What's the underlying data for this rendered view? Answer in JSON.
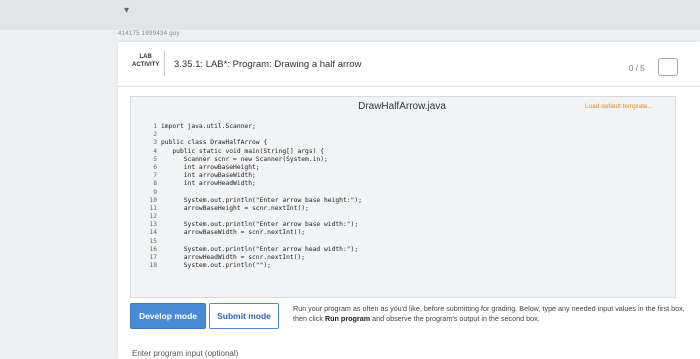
{
  "breadcrumb": "414175 1999434 goy",
  "lab": {
    "type_line1": "LAB",
    "type_line2": "ACTIVITY",
    "title": "3.35.1: LAB*: Program: Drawing a half arrow",
    "score": "0 / 5"
  },
  "editor": {
    "file_name": "DrawHalfArrow.java",
    "load_default_label": "Load default template...",
    "lines": [
      {
        "n": "1",
        "text": "import java.util.Scanner;"
      },
      {
        "n": "2",
        "text": ""
      },
      {
        "n": "3",
        "text": "public class DrawHalfArrow {"
      },
      {
        "n": "4",
        "text": "   public static void main(String[] args) {"
      },
      {
        "n": "5",
        "text": "      Scanner scnr = new Scanner(System.in);"
      },
      {
        "n": "6",
        "text": "      int arrowBaseHeight;"
      },
      {
        "n": "7",
        "text": "      int arrowBaseWidth;"
      },
      {
        "n": "8",
        "text": "      int arrowHeadWidth;"
      },
      {
        "n": "9",
        "text": ""
      },
      {
        "n": "10",
        "text": "      System.out.println(\"Enter arrow base height:\");"
      },
      {
        "n": "11",
        "text": "      arrowBaseHeight = scnr.nextInt();"
      },
      {
        "n": "12",
        "text": ""
      },
      {
        "n": "13",
        "text": "      System.out.println(\"Enter arrow base width:\");"
      },
      {
        "n": "14",
        "text": "      arrowBaseWidth = scnr.nextInt();"
      },
      {
        "n": "15",
        "text": ""
      },
      {
        "n": "16",
        "text": "      System.out.println(\"Enter arrow head width:\");"
      },
      {
        "n": "17",
        "text": "      arrowHeadWidth = scnr.nextInt();"
      },
      {
        "n": "18",
        "text": "      System.out.println(\"\");"
      }
    ]
  },
  "buttons": {
    "develop_mode": "Develop mode",
    "submit_mode": "Submit mode"
  },
  "instructions": {
    "part1": "Run your program as often as you'd like, before submitting for grading. Below, type any needed input values in the first box, then click ",
    "run_program": "Run program",
    "part2": " and observe the program's output in the second box."
  },
  "input_label": "Enter program input (optional)",
  "colors": {
    "accent_blue": "#4b8bd6",
    "load_default_orange": "#e58a2d"
  }
}
